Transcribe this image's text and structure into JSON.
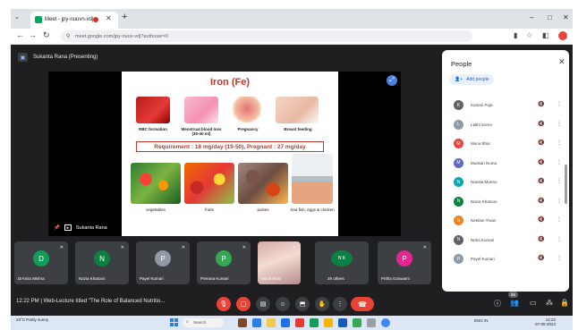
{
  "browser": {
    "tab_title": "Meet - jpy-nuuvn-vdj",
    "address": "meet.google.com/jpy-nuuv-vdj?authuser=0",
    "window_controls": [
      "–",
      "□",
      "✕"
    ]
  },
  "meet": {
    "presenting_label": "Sukanta Rana (Presenting)",
    "presenter_name_on_stage": "Sukanta Rana",
    "slide": {
      "title": "Iron (Fe)",
      "roles": [
        "RBC formation",
        "Menstrual blood loss (30-40 ml)",
        "Pregnancy",
        "Breast feeding"
      ],
      "requirement": "Requirement : 18 mg/day (19-50), Pregnant : 27 mg/day",
      "foods": [
        "vegetables",
        "fruits",
        "pulses",
        "Sea fish, eggs & chicken"
      ]
    },
    "tiles": [
      {
        "initial": "D",
        "name": "DrAnita Mishra",
        "color": "#0f9d58"
      },
      {
        "initial": "N",
        "name": "Nazia Khatoon",
        "color": "#0b8043"
      },
      {
        "initial": "P",
        "name": "Payel Kumari",
        "color": "#8f9aa6"
      },
      {
        "initial": "P",
        "name": "Prerana Kumari",
        "color": "#34a853"
      },
      {
        "initial": "",
        "name": "Muna Bhar",
        "color": ""
      },
      {
        "initial": "N K",
        "name": "29 others",
        "color": "#0b8043"
      },
      {
        "initial": "P",
        "name": "Pritha Goswami",
        "color": "#e52592"
      }
    ],
    "bottom_bar": {
      "time": "12:22 PM",
      "meeting_title": "Web-Lecture titled \"The Role of Balanced Nutritio...",
      "participant_count": "86"
    }
  },
  "people_panel": {
    "title": "People",
    "add_people": "Add people",
    "participants": [
      {
        "initial": "K",
        "name": "Kumari Puja",
        "color": "#5f6368"
      },
      {
        "initial": "L",
        "name": "Lakhi Soren",
        "color": "#8f9aa6"
      },
      {
        "initial": "M",
        "name": "Muna Bhar",
        "color": "#e8453c"
      },
      {
        "initial": "M",
        "name": "Muskan Noma",
        "color": "#5c6bc0"
      },
      {
        "initial": "N",
        "name": "Namita Murmu",
        "color": "#12a4af"
      },
      {
        "initial": "N",
        "name": "Nazia Khatoon",
        "color": "#0b8043"
      },
      {
        "initial": "N",
        "name": "Neelam Tiwari",
        "color": "#f4811f"
      },
      {
        "initial": "N",
        "name": "Neha Kumari",
        "color": "#5f6368"
      },
      {
        "initial": "P",
        "name": "Payel Kumari",
        "color": "#8f9aa6"
      }
    ]
  },
  "taskbar": {
    "weather": "23°C Partly sunny",
    "search": "Search",
    "tray": "ENG IN",
    "clock_time": "12:22",
    "clock_date": "07-05-2024"
  }
}
